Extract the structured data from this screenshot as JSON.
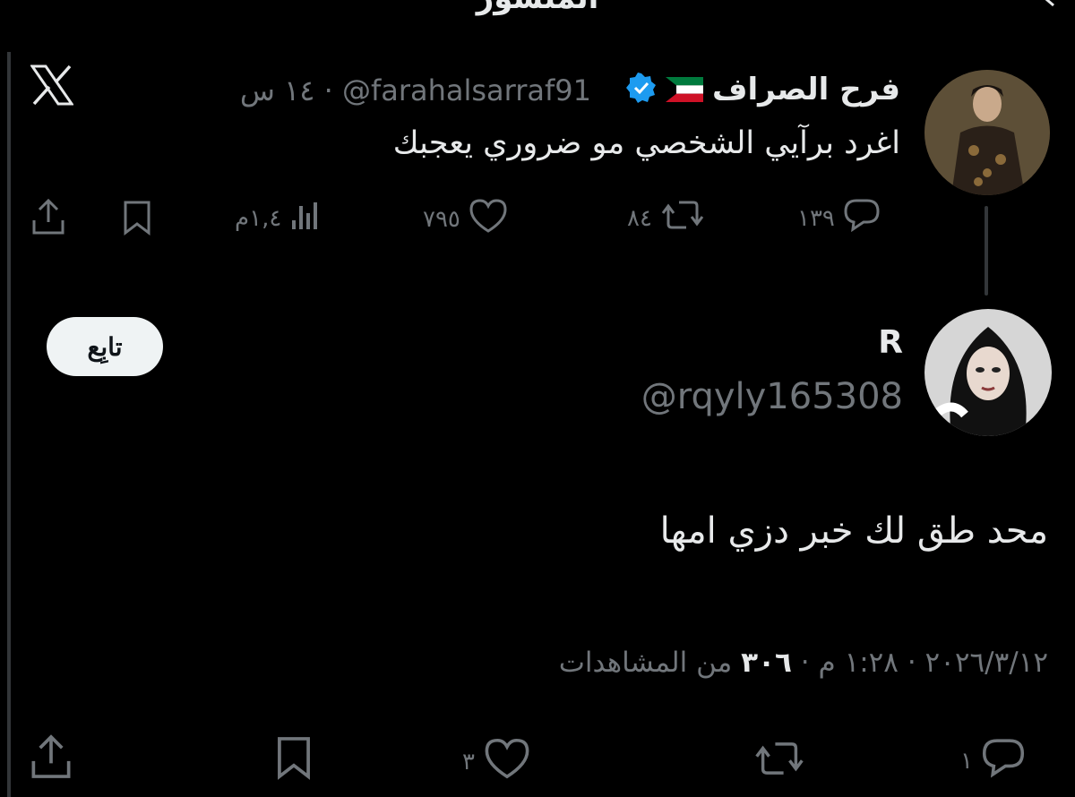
{
  "header": {
    "title": "المنشور"
  },
  "quoted_tweet": {
    "author_name": "فرح الصراف",
    "handle": "@farahalsarraf91",
    "time": "١٤ س",
    "separator": "·",
    "text": "اغرد برآيي الشخصي مو ضروري يعجبك",
    "replies": "١٣٩",
    "reposts": "٨٤",
    "likes": "٧٩٥",
    "views": "١,٤م"
  },
  "reply": {
    "author_name": "R",
    "handle": "@rqyly165308",
    "follow_label": "تابِع",
    "text": "محد طق لك خبر دزي امها",
    "date": "٢٠٢٦/٣/١٢",
    "time": "١:٢٨ م",
    "separator": "·",
    "views_count": "٣٠٦",
    "views_label": "من المشاهدات",
    "replies": "١",
    "likes": "٣"
  },
  "colors": {
    "background": "#000000",
    "text": "#e7e9ea",
    "muted": "#71767b",
    "verified": "#1d9bf0"
  }
}
